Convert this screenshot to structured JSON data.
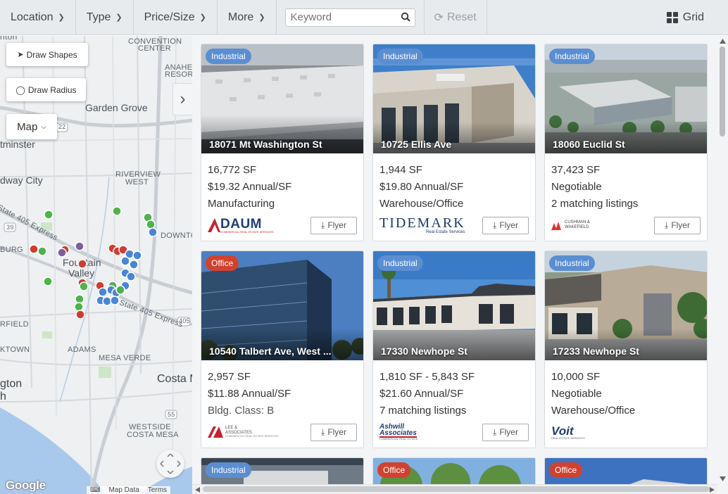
{
  "toolbar": {
    "location": "Location",
    "type": "Type",
    "price_size": "Price/Size",
    "more": "More",
    "keyword_placeholder": "Keyword",
    "reset": "Reset",
    "grid": "Grid"
  },
  "map": {
    "draw_shapes": "Draw Shapes",
    "draw_radius": "Draw Radius",
    "map_type": "Map",
    "labels": {
      "anton": "nton",
      "convention": "CONVENTION",
      "center": "CENTER",
      "anahei": "ANAHEI",
      "resort": "RESOR",
      "garden_grove": "Garden Grove",
      "route_22": "22",
      "tminster": "tminster",
      "riverview": "RIVERVIEW",
      "west": "WEST",
      "way_city": "dway City",
      "state_405_upper": "State 405 Express",
      "route_39": "39",
      "burg": "BURG",
      "fountain": "Fountain",
      "valley": "Valley",
      "downtown": "DOWNTOWN",
      "state_405_lower": "State 405 Express",
      "route_405": "405",
      "rfield": "RFIELD",
      "ktown": "KTOWN",
      "adams": "ADAMS",
      "mesa_verde": "MESA VERDE",
      "gton": "gton",
      "h": "h",
      "costa_m": "Costa M",
      "route_55": "55",
      "westside": "WESTSIDE",
      "costa_mesa_sm": "COSTA MESA"
    },
    "google": "Google",
    "map_data": "Map Data",
    "terms": "Terms"
  },
  "listings": [
    {
      "category": "Industrial",
      "address": "18071 Mt Washington St",
      "line1": "16,772 SF",
      "line2": "$19.32 Annual/SF",
      "line3": "Manufacturing",
      "broker": "DAUM",
      "broker_sub": "COMMERCIAL REAL ESTATE SERVICES",
      "flyer": "Flyer"
    },
    {
      "category": "Industrial",
      "address": "10725 Ellis Ave",
      "line1": "1,944 SF",
      "line2": "$19.80 Annual/SF",
      "line3": "Warehouse/Office",
      "broker": "TIDEMARK",
      "broker_sub": "Real Estate Services",
      "flyer": "Flyer"
    },
    {
      "category": "Industrial",
      "address": "18060 Euclid St",
      "line1": "37,423 SF",
      "line2": "Negotiable",
      "line3": "2 matching listings",
      "broker": "CUSHMAN &",
      "broker_sub": "WAKEFIELD",
      "flyer": "Flyer"
    },
    {
      "category": "Office",
      "address": "10540 Talbert Ave, West ...",
      "line1": "2,957 SF",
      "line2": "$11.88 Annual/SF",
      "line3": "Bldg. Class: B",
      "broker": "LEE &",
      "broker_sub": "ASSOCIATES",
      "broker_sub2": "COMMERCIAL REAL ESTATE SERVICES",
      "flyer": "Flyer"
    },
    {
      "category": "Industrial",
      "address": "17330 Newhope St",
      "line1": "1,810 SF - 5,843 SF",
      "line2": "$21.60 Annual/SF",
      "line3": "7 matching listings",
      "broker": "Ashwill",
      "broker_sub": "Associates",
      "broker_sub2": "COMMERCIAL REAL ESTATE",
      "flyer": "Flyer"
    },
    {
      "category": "Industrial",
      "address": "17233 Newhope St",
      "line1": "10,000 SF",
      "line2": "Negotiable",
      "line3": "Warehouse/Office",
      "broker": "Voit",
      "broker_sub": "REAL ESTATE SERVICES"
    }
  ],
  "partial_badges": [
    "Industrial",
    "Office",
    "Office"
  ],
  "colors": {
    "industrial": "#5b8ed1",
    "office": "#d2412f",
    "pin_blue": "#4a86d8",
    "pin_green": "#4bb54a",
    "pin_red": "#d43a2f",
    "pin_purple": "#7d5f9e"
  }
}
